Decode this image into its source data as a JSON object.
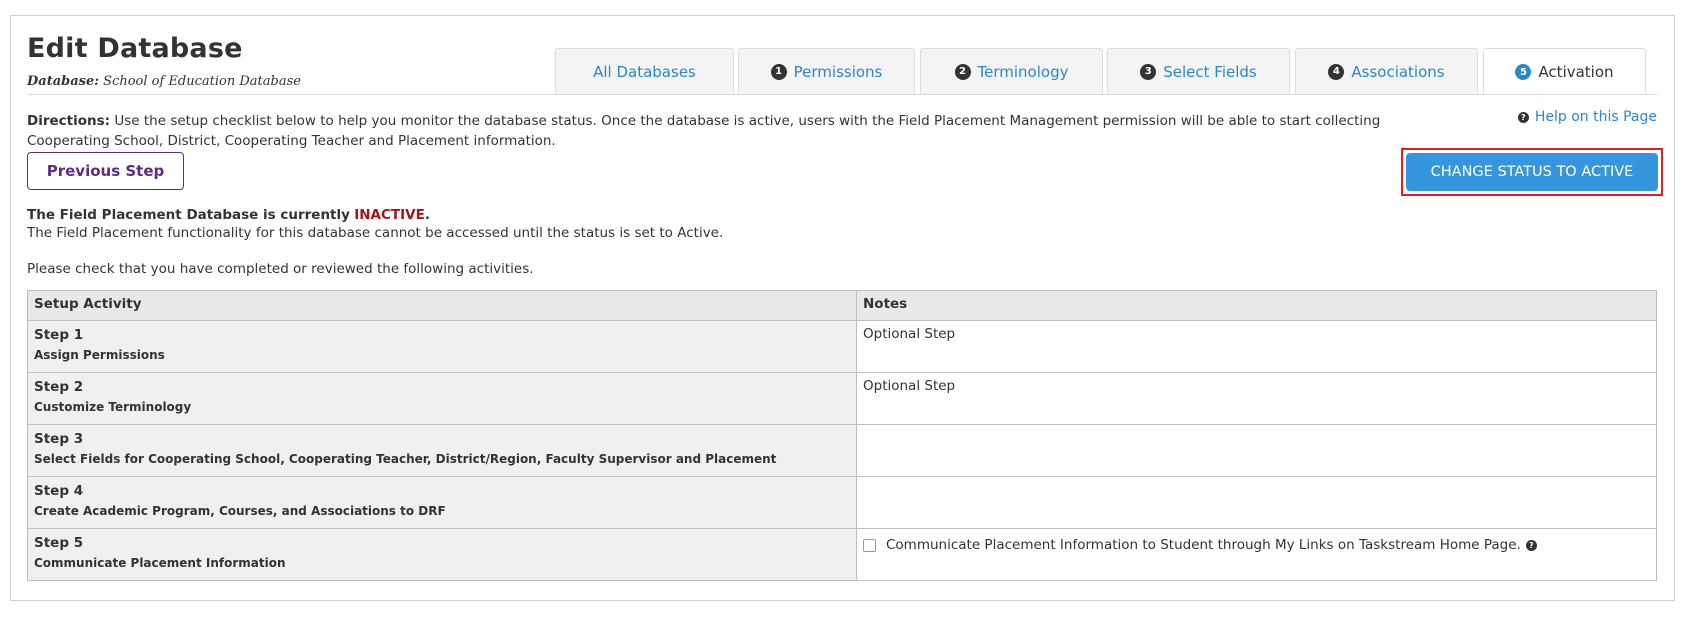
{
  "header": {
    "title": "Edit Database",
    "database_label": "Database:",
    "database_name": "School of Education Database"
  },
  "tabs": [
    {
      "label": "All Databases",
      "number": ""
    },
    {
      "label": "Permissions",
      "number": "1"
    },
    {
      "label": "Terminology",
      "number": "2"
    },
    {
      "label": "Select Fields",
      "number": "3"
    },
    {
      "label": "Associations",
      "number": "4"
    },
    {
      "label": "Activation",
      "number": "5",
      "active": true
    }
  ],
  "directions": {
    "label": "Directions:",
    "text": "Use the setup checklist below to help you monitor the database status. Once the database is active, users with the Field Placement Management permission will be able to start collecting Cooperating School, District, Cooperating Teacher and Placement information."
  },
  "help": {
    "icon": "question-icon",
    "label": "Help on this Page"
  },
  "buttons": {
    "previous_step": "Previous Step",
    "change_status": "CHANGE STATUS TO ACTIVE"
  },
  "status": {
    "prefix": "The Field Placement Database is currently",
    "value": "INACTIVE",
    "suffix": ".",
    "value_color": "#a31515",
    "detail": "The Field Placement functionality for this database cannot be accessed until the status is set to Active.",
    "check_note": "Please check that you have completed or reviewed the following activities."
  },
  "table": {
    "headers": [
      "Setup Activity",
      "Notes"
    ],
    "rows": [
      {
        "step": "Step 1",
        "desc": "Assign Permissions",
        "note": "Optional Step"
      },
      {
        "step": "Step 2",
        "desc": "Customize Terminology",
        "note": "Optional Step"
      },
      {
        "step": "Step 3",
        "desc": "Select Fields for Cooperating School, Cooperating Teacher, District/Region, Faculty Supervisor and Placement",
        "note": ""
      },
      {
        "step": "Step 4",
        "desc": "Create Academic Program, Courses, and Associations to DRF",
        "note": ""
      },
      {
        "step": "Step 5",
        "desc": "Communicate Placement Information",
        "note": "",
        "checkbox_label": "Communicate Placement Information to Student through My Links on Taskstream Home Page.",
        "checked": false
      }
    ]
  },
  "colors": {
    "accent": "#2a87c9",
    "primary_button": "#3596de",
    "previous_button": "#5b2d86",
    "highlight_border": "#e02020"
  }
}
